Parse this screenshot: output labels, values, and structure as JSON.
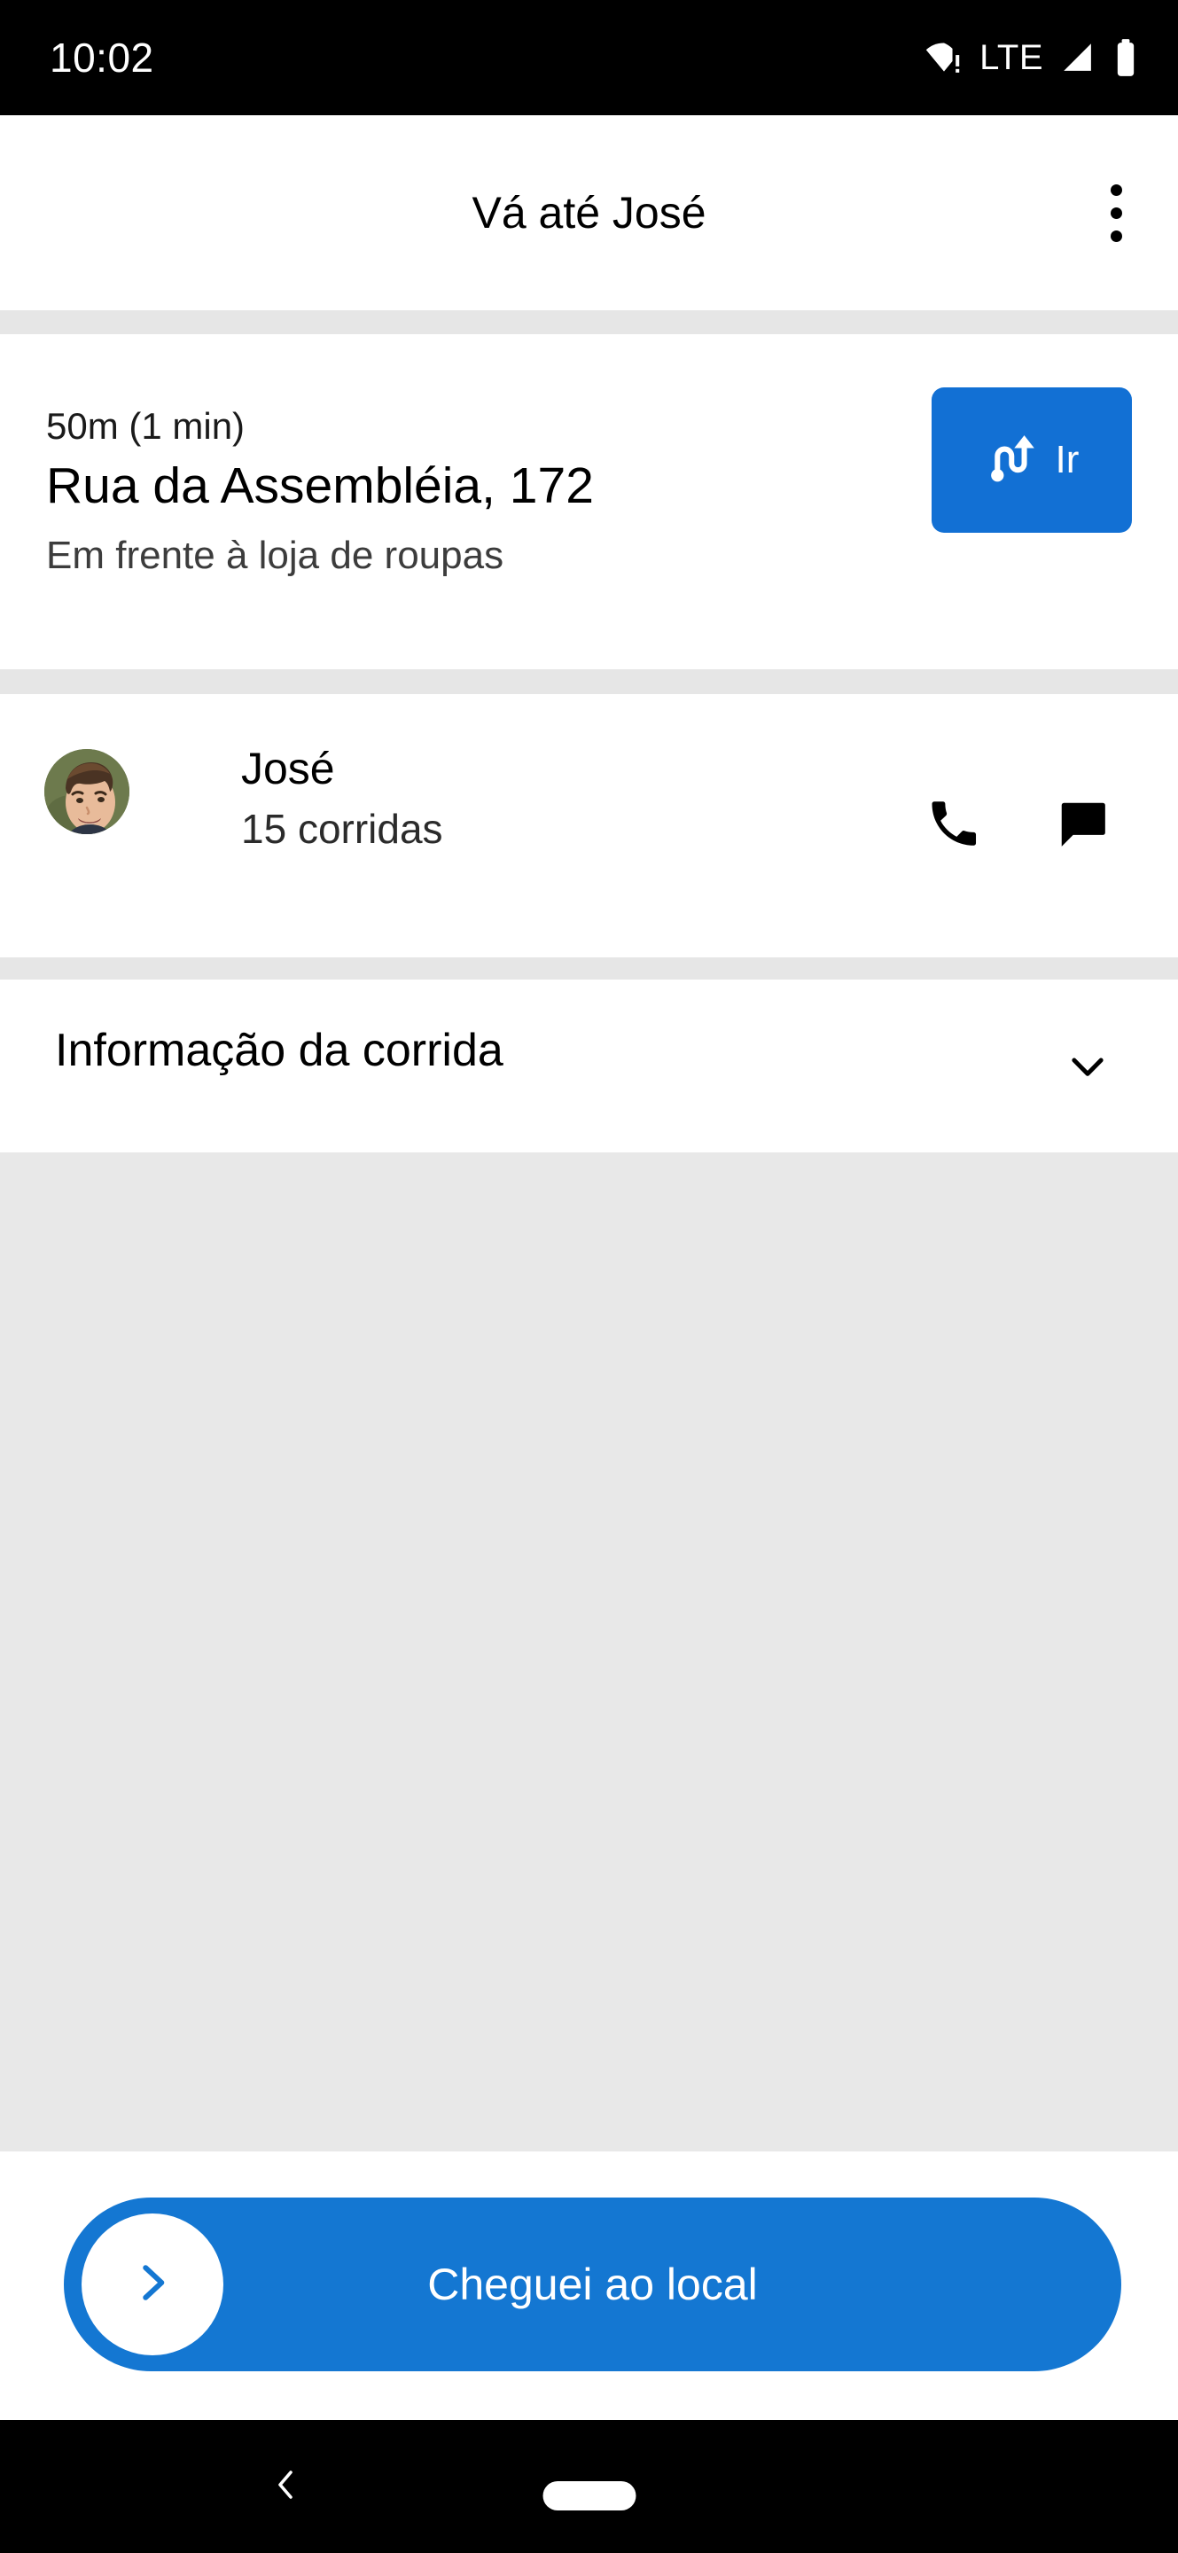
{
  "status_bar": {
    "time": "10:02",
    "network_label": "LTE",
    "icons": [
      "wifi-warning-icon",
      "signal-icon",
      "battery-icon"
    ]
  },
  "app_bar": {
    "title": "Vá até José",
    "overflow_icon": "more-vert-icon"
  },
  "destination": {
    "eta": "50m (1 min)",
    "address": "Rua da Assembléia, 172",
    "note": "Em frente à loja de roupas",
    "go_button_label": "Ir",
    "go_button_icon": "navigation-route-icon",
    "accent_color": "#1270D4"
  },
  "rider": {
    "name": "José",
    "rides": "15 corridas",
    "avatar_alt": "jose-avatar",
    "call_icon": "phone-icon",
    "message_icon": "chat-bubble-icon"
  },
  "ride_info": {
    "label": "Informação da corrida",
    "expand_icon": "chevron-down-icon",
    "expanded": false
  },
  "cta": {
    "label": "Cheguei ao local",
    "handle_icon": "chevron-right-icon",
    "color": "#1477D2"
  },
  "nav_bar": {
    "back_icon": "chevron-back-icon",
    "home_icon": "home-pill-icon"
  },
  "colors": {
    "accent": "#1270D4",
    "divider": "#E6E6E6",
    "content_background": "#E8E8E8",
    "surface": "#FFFFFF",
    "system_bar": "#000000"
  }
}
